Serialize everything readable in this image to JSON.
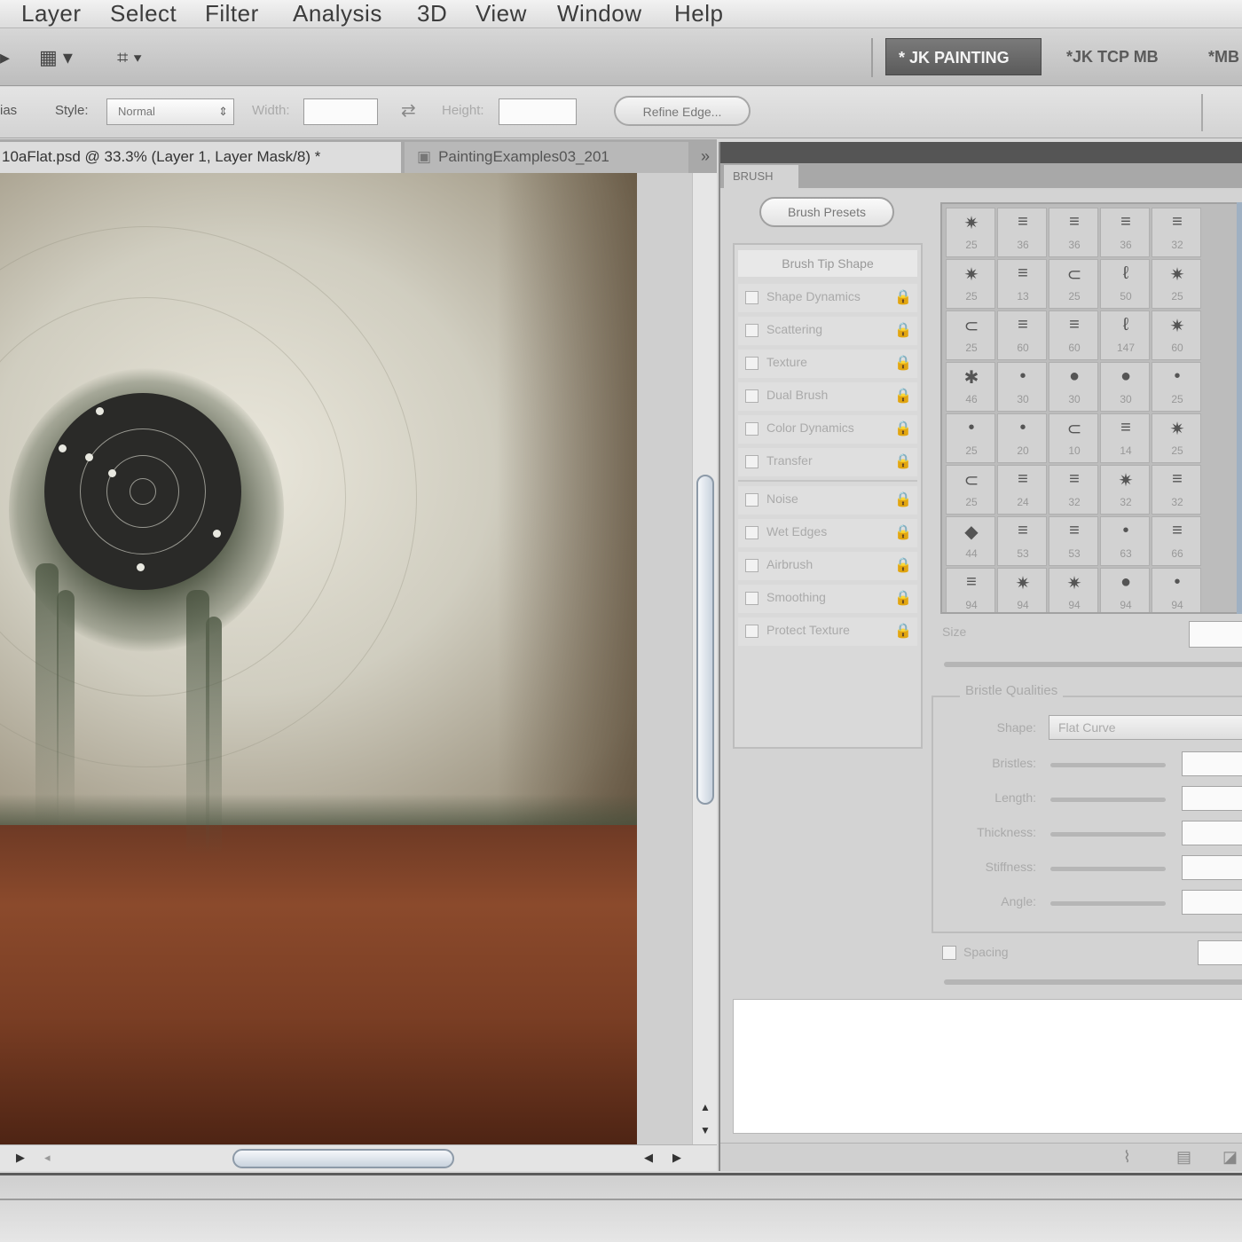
{
  "menu": {
    "items": [
      "Layer",
      "Select",
      "Filter",
      "Analysis",
      "3D",
      "View",
      "Window",
      "Help"
    ]
  },
  "workspaces": {
    "active": "* JK PAINTING",
    "second": "*JK TCP MB",
    "third": "*MB"
  },
  "options_bar": {
    "left_label": "ias",
    "style_label": "Style:",
    "style_value": "Normal",
    "width_label": "Width:",
    "height_label": "Height:",
    "refine_edge": "Refine Edge..."
  },
  "documents": {
    "active_tab": "10aFlat.psd @ 33.3% (Layer 1, Layer Mask/8) *",
    "inactive_tab": "PaintingExamples03_201",
    "overflow": "»"
  },
  "brush_panel": {
    "tab_label": "BRUSH",
    "presets_button": "Brush Presets",
    "tip_shape": "Brush Tip Shape",
    "options": [
      "Shape Dynamics",
      "Scattering",
      "Texture",
      "Dual Brush",
      "Color Dynamics",
      "Transfer",
      "Noise",
      "Wet Edges",
      "Airbrush",
      "Smoothing",
      "Protect Texture"
    ],
    "brush_sizes": [
      "25",
      "36",
      "36",
      "36",
      "32",
      "25",
      "13",
      "25",
      "50",
      "25",
      "25",
      "60",
      "60",
      "147",
      "60",
      "46",
      "30",
      "30",
      "30",
      "25",
      "25",
      "20",
      "10",
      "14",
      "25",
      "25",
      "24",
      "32",
      "32",
      "32",
      "44",
      "53",
      "53",
      "63",
      "66",
      "94",
      "94",
      "94",
      "94",
      "94"
    ],
    "brush_glyphs": [
      "✷",
      "≡",
      "≡",
      "≡",
      "≡",
      "✷",
      "≡",
      "⊂",
      "ℓ",
      "✷",
      "⊂",
      "≡",
      "≡",
      "ℓ",
      "✷",
      "✱",
      "•",
      "●",
      "●",
      "•",
      "•",
      "•",
      "⊂",
      "≡",
      "✷",
      "⊂",
      "≡",
      "≡",
      "✷",
      "≡",
      "◆",
      "≡",
      "≡",
      "•",
      "≡",
      "≡",
      "✷",
      "✷",
      "●",
      "•"
    ],
    "size_label": "Size",
    "bristle_title": "Bristle Qualities",
    "shape_label": "Shape:",
    "shape_value": "Flat Curve",
    "bristle_fields": [
      "Bristles:",
      "Length:",
      "Thickness:",
      "Stiffness:",
      "Angle:"
    ],
    "spacing_label": "Spacing"
  }
}
